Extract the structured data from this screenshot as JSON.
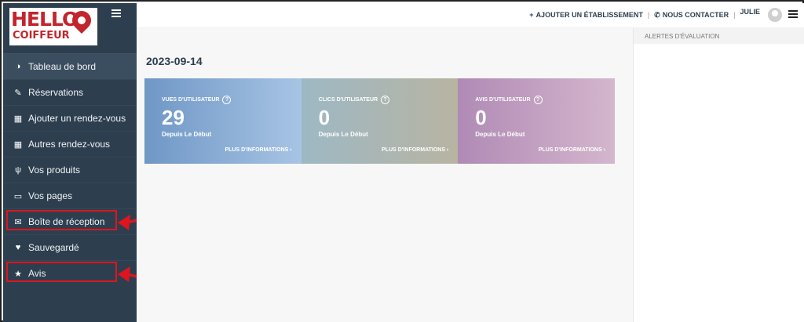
{
  "logo": {
    "line1": "HELLO",
    "line2": "COIFFEUR"
  },
  "sidebar": {
    "items": [
      {
        "label": "Tableau de bord",
        "icon": "dashboard-icon",
        "glyph": "◑",
        "active": true
      },
      {
        "label": "Réservations",
        "icon": "edit-icon",
        "glyph": "✎"
      },
      {
        "label": "Ajouter un rendez-vous",
        "icon": "calendar-icon",
        "glyph": "▦"
      },
      {
        "label": "Autres rendez-vous",
        "icon": "calendar-icon",
        "glyph": "▦"
      },
      {
        "label": "Vos produits",
        "icon": "utensils-icon",
        "glyph": "ψ"
      },
      {
        "label": "Vos pages",
        "icon": "id-card-icon",
        "glyph": "▭"
      },
      {
        "label": "Boîte de réception",
        "icon": "envelope-icon",
        "glyph": "✉"
      },
      {
        "label": "Sauvegardé",
        "icon": "heart-icon",
        "glyph": "♥"
      },
      {
        "label": "Avis",
        "icon": "star-icon",
        "glyph": "★"
      }
    ]
  },
  "topbar": {
    "add_label": "AJOUTER UN ÉTABLISSEMENT",
    "add_glyph": "+",
    "contact_label": "NOUS CONTACTER",
    "contact_glyph": "✆",
    "user": "JULIE"
  },
  "main": {
    "date": "2023-09-14",
    "cards": [
      {
        "label": "VUES D'UTILISATEUR",
        "value": "29",
        "since": "Depuis Le Début",
        "more": "PLUS D'INFORMATIONS ›"
      },
      {
        "label": "CLICS D'UTILISATEUR",
        "value": "0",
        "since": "Depuis Le Début",
        "more": "PLUS D'INFORMATIONS ›"
      },
      {
        "label": "AVIS D'UTILISATEUR",
        "value": "0",
        "since": "Depuis Le Début",
        "more": "PLUS D'INFORMATIONS ›"
      }
    ]
  },
  "right_panel": {
    "title": "ALERTES D'ÉVALUATION"
  },
  "colors": {
    "sidebar": "#2d3f4f",
    "highlight": "#e0141e",
    "brand": "#c2252c"
  }
}
